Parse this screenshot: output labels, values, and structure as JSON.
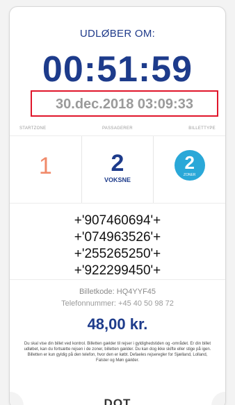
{
  "ticket": {
    "expires_label": "UDLØBER OM:",
    "countdown": "00:51:59",
    "timestamp": "30.dec.2018 03:09:33",
    "col_headers": [
      "STARTZONE",
      "PASSAGERER",
      "BILLETTYPE"
    ],
    "start_zone": "1",
    "passengers": "2",
    "passenger_type": "VOKSNE",
    "ticket_type_number": "2",
    "ticket_type_label": "ZONER",
    "codes": [
      "+'907460694'+",
      "+'074963526'+",
      "+'255265250'+",
      "+'922299450'+"
    ],
    "ticket_code": "Billetkode: HQ4YYF45",
    "phone": "Telefonnummer: +45 40 50 98 72",
    "price": "48,00 kr.",
    "notice": "Du skal vise din billet ved kontrol. Billetten gælder til rejser i gyldighedstiden og -området. Er din billet udløbet, kan du fortsætte rejsen i de zoner, billetten gælder. Du kan dog ikke skifte eller stige på igen. Billetten er kun gyldig på den telefon, hvor den er købt. Defaeles rejseregler for Sjælland, Lolland, Falster og Møn gælder.",
    "brand": "DOT"
  },
  "colors": {
    "accent_blue": "#1d3b8b",
    "zone_orange": "#f08a6a",
    "badge_cyan": "#2aa8d8",
    "highlight_red": "#e0152a"
  }
}
